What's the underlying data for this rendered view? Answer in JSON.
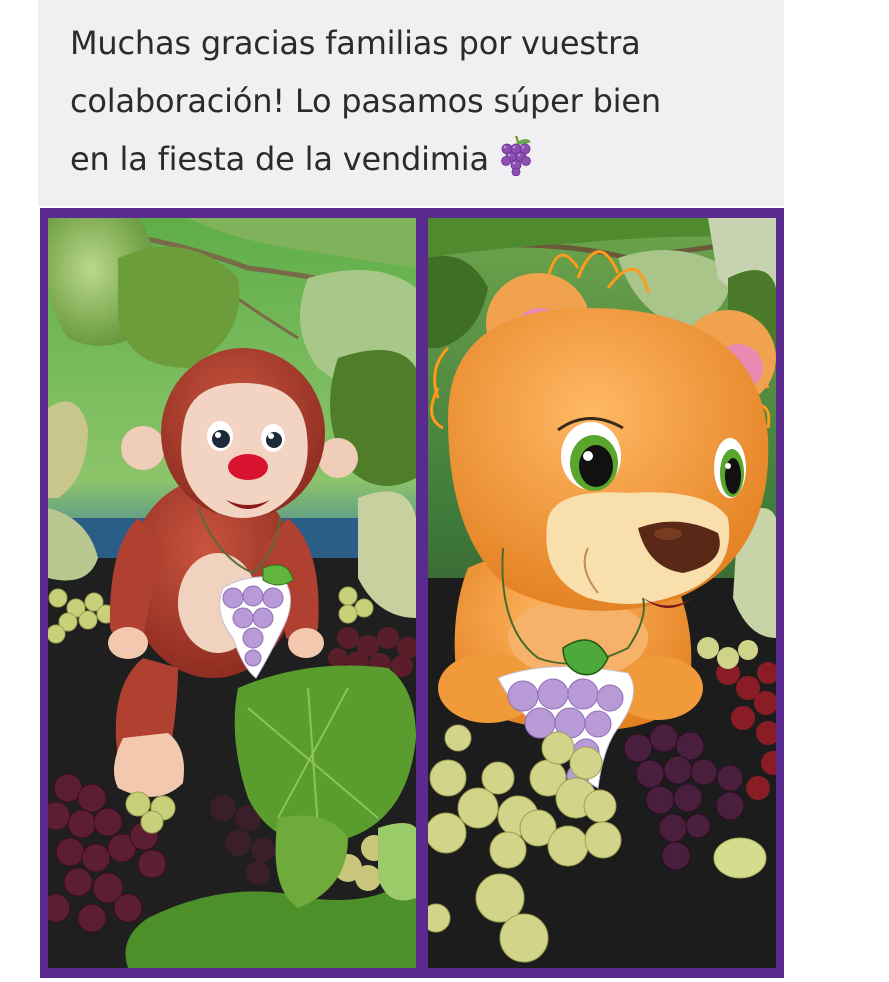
{
  "post": {
    "caption_lines": [
      "Muchas gracias familias por vuestra",
      "colaboración! Lo pasamos súper bien",
      "en la fiesta de la vendimia"
    ],
    "caption_emoji_icon": "grapes-icon"
  },
  "photos": [
    {
      "subject": "monkey-plush",
      "icon": "monkey-plush-photo"
    },
    {
      "subject": "lion-plush",
      "icon": "lion-plush-photo"
    }
  ],
  "colors": {
    "frame": "#5b2a8e",
    "caption_bg": "#f0eff2",
    "caption_text": "#2b2b2b"
  }
}
